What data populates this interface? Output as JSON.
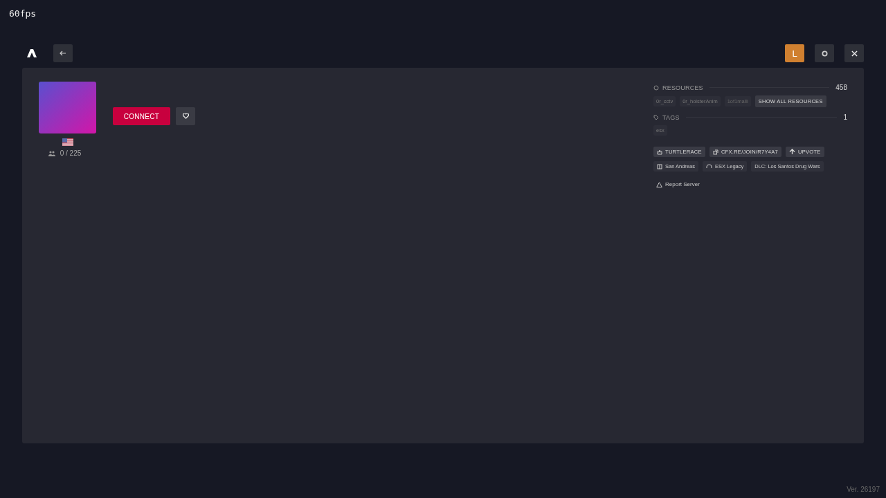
{
  "fps": "60fps",
  "user": {
    "initial": "L"
  },
  "server": {
    "kind": "picture",
    "connect": "CONNECT",
    "players": "0 / 225"
  },
  "resources": {
    "title": "RESOURCES",
    "count": "458",
    "items": [
      "0r_cctv",
      "0r_holsterAnim",
      "1of1malli"
    ],
    "show_all": "SHOW ALL RESOURCES"
  },
  "tags": {
    "title": "TAGS",
    "count": "1",
    "items": [
      "esx"
    ]
  },
  "actions": [
    {
      "kind": "owner",
      "label": "TURTLERACE"
    },
    {
      "kind": "link",
      "label": "CFX.RE/JOIN/R7Y4A7"
    },
    {
      "kind": "upvote",
      "label": "UPVOTE"
    }
  ],
  "info": [
    {
      "kind": "map",
      "label": "San Andreas"
    },
    {
      "kind": "gametype",
      "label": "ESX Legacy"
    },
    {
      "kind": "plain",
      "label": "DLC: Los Santos Drug Wars"
    }
  ],
  "report": "Report Server",
  "version": "Ver. 26197"
}
